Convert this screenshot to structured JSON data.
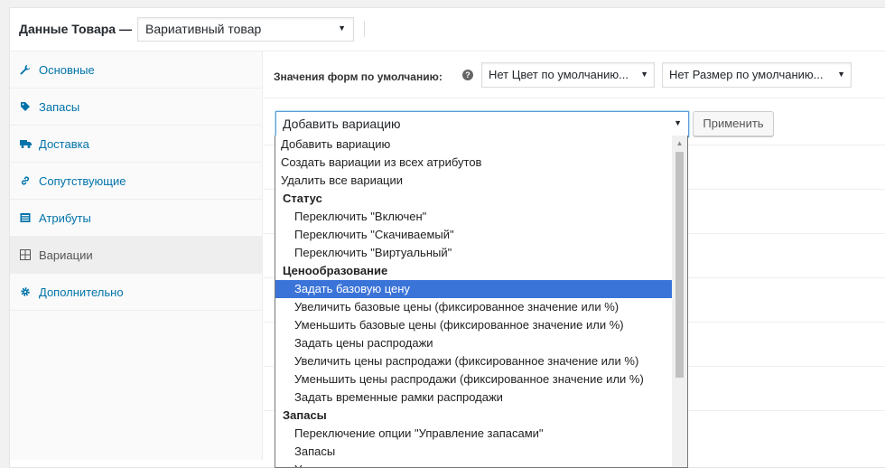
{
  "header": {
    "title": "Данные Товара —",
    "product_type": "Вариативный товар"
  },
  "tabs": [
    {
      "label": "Основные",
      "icon": "wrench-icon"
    },
    {
      "label": "Запасы",
      "icon": "tag-icon"
    },
    {
      "label": "Доставка",
      "icon": "truck-icon"
    },
    {
      "label": "Сопутствующие",
      "icon": "link-icon"
    },
    {
      "label": "Атрибуты",
      "icon": "table-icon"
    },
    {
      "label": "Вариации",
      "icon": "grid-icon",
      "active": true
    },
    {
      "label": "Дополнительно",
      "icon": "gear-icon"
    }
  ],
  "defaults": {
    "label": "Значения форм по умолчанию:",
    "color_select": "Нет Цвет по умолчанию...",
    "size_select": "Нет Размер по умолчанию..."
  },
  "bulk": {
    "selected": "Добавить вариацию",
    "apply_label": "Применить"
  },
  "dropdown": {
    "items": [
      {
        "text": "Добавить вариацию",
        "kind": "option"
      },
      {
        "text": "Создать вариации из всех атрибутов",
        "kind": "option"
      },
      {
        "text": "Удалить все вариации",
        "kind": "option"
      },
      {
        "text": "Статус",
        "kind": "group"
      },
      {
        "text": "Переключить \"Включен\"",
        "kind": "sub"
      },
      {
        "text": "Переключить \"Скачиваемый\"",
        "kind": "sub"
      },
      {
        "text": "Переключить \"Виртуальный\"",
        "kind": "sub"
      },
      {
        "text": "Ценообразование",
        "kind": "group"
      },
      {
        "text": "Задать базовую цену",
        "kind": "sub",
        "highlighted": true
      },
      {
        "text": "Увеличить базовые цены (фиксированное значение или %)",
        "kind": "sub"
      },
      {
        "text": "Уменьшить базовые цены (фиксированное значение или %)",
        "kind": "sub"
      },
      {
        "text": "Задать цены распродажи",
        "kind": "sub"
      },
      {
        "text": "Увеличить цены распродажи (фиксированное значение или %)",
        "kind": "sub"
      },
      {
        "text": "Уменьшить цены распродажи (фиксированное значение или %)",
        "kind": "sub"
      },
      {
        "text": "Задать временные рамки распродажи",
        "kind": "sub"
      },
      {
        "text": "Запасы",
        "kind": "group"
      },
      {
        "text": "Переключение опции \"Управление запасами\"",
        "kind": "sub"
      },
      {
        "text": "Запасы",
        "kind": "sub"
      },
      {
        "text": "У",
        "kind": "sub"
      }
    ]
  },
  "colors": {
    "link": "#0073aa",
    "highlight": "#3b74d8",
    "focus_border": "#5b9dd9"
  }
}
